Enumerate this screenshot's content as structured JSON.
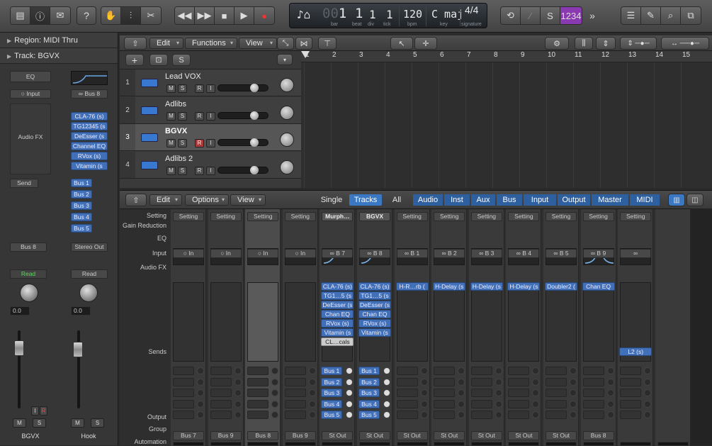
{
  "toolbar": {
    "lcd": {
      "bar": "1",
      "beat": "1",
      "div": "1",
      "tick": "1",
      "bpm": "120",
      "key": "C maj",
      "signature": "4/4",
      "bar_cap": "bar",
      "beat_cap": "beat",
      "div_cap": "div",
      "tick_cap": "tick",
      "bpm_cap": "bpm",
      "key_cap": "key",
      "sig_cap": "signature",
      "digits_prefix": "00"
    },
    "count_in": "1234",
    "solo_label": "S"
  },
  "inspector": {
    "region": "Region: MIDI Thru",
    "track": "Track:  BGVX",
    "strip1": {
      "eq": "EQ",
      "input": "Input",
      "audiofx": "Audio FX",
      "send": "Send",
      "output": "Bus 8",
      "auto": "Read",
      "vol": "0.0",
      "name": "BGVX",
      "mute": "M",
      "solo": "S",
      "rec": "R",
      "in": "I"
    },
    "strip2": {
      "input": "Bus 8",
      "plugins": [
        "CLA-76 (s)",
        "TG12345 (s",
        "DeEsser (s",
        "Channel EQ",
        "RVox (s)",
        "Vitamin (s"
      ],
      "sends": [
        "Bus 1",
        "Bus 2",
        "Bus 3",
        "Bus 4",
        "Bus 5"
      ],
      "output": "Stereo Out",
      "auto": "Read",
      "vol": "0.0",
      "name": "Hook",
      "mute": "M",
      "solo": "S"
    }
  },
  "tracks": {
    "menus": {
      "edit": "Edit",
      "functions": "Functions",
      "view": "View"
    },
    "add": "+",
    "s": "S",
    "items": [
      {
        "num": "1",
        "name": "Lead VOX"
      },
      {
        "num": "2",
        "name": "Adlibs"
      },
      {
        "num": "3",
        "name": "BGVX"
      },
      {
        "num": "4",
        "name": "Adlibs 2"
      }
    ],
    "buttons": {
      "m": "M",
      "s": "S",
      "r": "R",
      "i": "I"
    },
    "ruler": [
      "1",
      "2",
      "3",
      "4",
      "5",
      "6",
      "7",
      "8",
      "9",
      "10",
      "11",
      "12",
      "13",
      "14",
      "15"
    ]
  },
  "mixer": {
    "menus": {
      "edit": "Edit",
      "options": "Options",
      "view": "View"
    },
    "filters": [
      "Single",
      "Tracks",
      "All"
    ],
    "groups": [
      "Audio",
      "Inst",
      "Aux",
      "Bus",
      "Input",
      "Output",
      "Master",
      "MIDI"
    ],
    "rows": {
      "setting": "Setting",
      "gain": "Gain Reduction",
      "eq": "EQ",
      "input": "Input",
      "audiofx": "Audio FX",
      "sends": "Sends",
      "output": "Output",
      "group": "Group",
      "automation": "Automation"
    },
    "channels": [
      {
        "setting": "Setting",
        "input": "In",
        "fx": [],
        "sends": [],
        "output": "Bus 7",
        "auto": "Read"
      },
      {
        "setting": "Setting",
        "input": "In",
        "fx": [],
        "sends": [],
        "output": "Bus 9",
        "auto": "Read"
      },
      {
        "setting": "Setting",
        "input": "In",
        "fx": [],
        "sends": [],
        "output": "Bus 8",
        "auto": "Read"
      },
      {
        "setting": "Setting",
        "input": "In",
        "fx": [],
        "sends": [],
        "output": "Bus 9",
        "auto": "Read"
      },
      {
        "setting": "Murph…",
        "input": "B 7",
        "fx": [
          "CLA-76 (s)",
          "TG1…5 (s",
          "DeEsser (s",
          "Chan EQ",
          "RVox (s)",
          "Vitamin (s",
          "CL…cals"
        ],
        "sends": [
          "Bus 1",
          "Bus 2",
          "Bus 3",
          "Bus 4",
          "Bus 5"
        ],
        "output": "St Out",
        "auto": "Read"
      },
      {
        "setting": "BGVX",
        "input": "B 8",
        "fx": [
          "CLA-76 (s)",
          "TG1…5 (s",
          "DeEsser (s",
          "Chan EQ",
          "RVox (s)",
          "Vitamin (s"
        ],
        "sends": [
          "Bus 1",
          "Bus 2",
          "Bus 3",
          "Bus 4",
          "Bus 5"
        ],
        "output": "St Out",
        "auto": "Read"
      },
      {
        "setting": "Setting",
        "input": "B 1",
        "fx": [
          "H-R…rb ("
        ],
        "sends": [],
        "output": "St Out",
        "auto": "Read"
      },
      {
        "setting": "Setting",
        "input": "B 2",
        "fx": [
          "H-Delay (s"
        ],
        "sends": [],
        "output": "St Out",
        "auto": "Read"
      },
      {
        "setting": "Setting",
        "input": "B 3",
        "fx": [
          "H-Delay (s"
        ],
        "sends": [],
        "output": "St Out",
        "auto": "Read"
      },
      {
        "setting": "Setting",
        "input": "B 4",
        "fx": [
          "H-Delay (s"
        ],
        "sends": [],
        "output": "St Out",
        "auto": "Read"
      },
      {
        "setting": "Setting",
        "input": "B 5",
        "fx": [
          "Doubler2 ("
        ],
        "sends": [],
        "output": "St Out",
        "auto": "Read"
      },
      {
        "setting": "Setting",
        "input": "B 9",
        "fx": [
          "Chan EQ"
        ],
        "sends": [],
        "output": "Bus 8",
        "auto": "Read"
      },
      {
        "setting": "Setting",
        "input": "",
        "fx": [],
        "fxlow": "L2 (s)",
        "sends": [],
        "output": "",
        "auto": "Read"
      },
      {
        "setting": "",
        "input": "",
        "fx": [],
        "sends": [],
        "output": "",
        "auto": "Read"
      }
    ]
  }
}
